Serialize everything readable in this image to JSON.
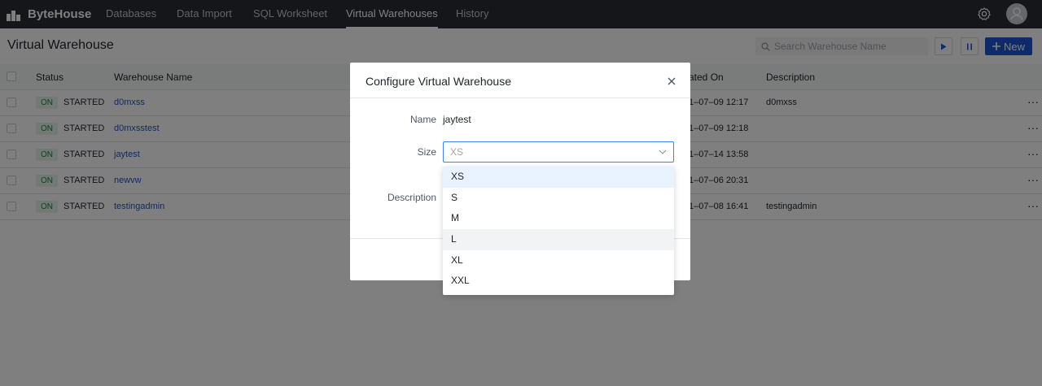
{
  "nav": {
    "brand": "ByteHouse",
    "items": [
      "Databases",
      "Data Import",
      "SQL Worksheet",
      "Virtual Warehouses",
      "History"
    ],
    "active": "Virtual Warehouses"
  },
  "page": {
    "title": "Virtual Warehouse",
    "search_placeholder": "Search Warehouse Name",
    "new_label": "New"
  },
  "table": {
    "headers": {
      "status": "Status",
      "name": "Warehouse Name",
      "created": "ated On",
      "description": "Description"
    },
    "rows": [
      {
        "on": "ON",
        "state": "STARTED",
        "name": "d0mxss",
        "created": "1–07–09 12:17",
        "description": "d0mxss"
      },
      {
        "on": "ON",
        "state": "STARTED",
        "name": "d0mxsstest",
        "created": "1–07–09 12:18",
        "description": ""
      },
      {
        "on": "ON",
        "state": "STARTED",
        "name": "jaytest",
        "created": "1–07–14 13:58",
        "description": ""
      },
      {
        "on": "ON",
        "state": "STARTED",
        "name": "newvw",
        "created": "1–07–06 20:31",
        "description": ""
      },
      {
        "on": "ON",
        "state": "STARTED",
        "name": "testingadmin",
        "created": "1–07–08 16:41",
        "description": "testingadmin"
      }
    ],
    "more": "···"
  },
  "modal": {
    "title": "Configure Virtual Warehouse",
    "name_label": "Name",
    "name_value": "jaytest",
    "size_label": "Size",
    "size_placeholder": "XS",
    "description_label": "Description",
    "size_options": [
      "XS",
      "S",
      "M",
      "L",
      "XL",
      "XXL"
    ],
    "selected_option": "XS",
    "hovered_option": "L"
  },
  "colors": {
    "nav_bg": "#282c33",
    "accent": "#1e55d6",
    "status_green": "#1a8a3c"
  }
}
